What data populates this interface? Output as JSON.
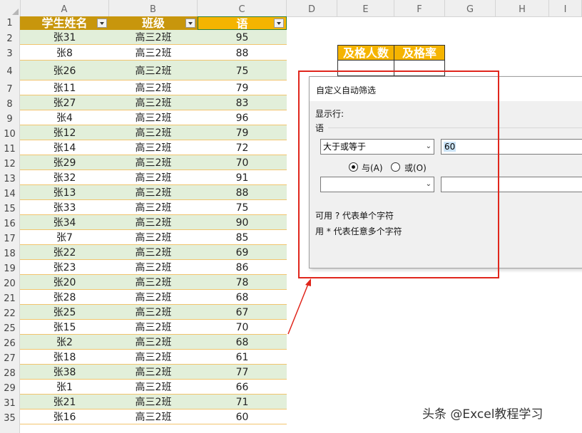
{
  "columns": [
    "A",
    "B",
    "C",
    "D",
    "E",
    "F",
    "G",
    "H",
    "I"
  ],
  "header": {
    "name": "学生姓名",
    "class": "班级",
    "score": "语"
  },
  "rows": [
    {
      "num": "2",
      "name": "张31",
      "class": "高三2班",
      "score": "95"
    },
    {
      "num": "3",
      "name": "张8",
      "class": "高三2班",
      "score": "88"
    },
    {
      "num": "4",
      "name": "张26",
      "class": "高三2班",
      "score": "75"
    },
    {
      "num": "7",
      "name": "张11",
      "class": "高三2班",
      "score": "79"
    },
    {
      "num": "8",
      "name": "张27",
      "class": "高三2班",
      "score": "83"
    },
    {
      "num": "9",
      "name": "张4",
      "class": "高三2班",
      "score": "96"
    },
    {
      "num": "10",
      "name": "张12",
      "class": "高三2班",
      "score": "79"
    },
    {
      "num": "11",
      "name": "张14",
      "class": "高三2班",
      "score": "72"
    },
    {
      "num": "12",
      "name": "张29",
      "class": "高三2班",
      "score": "70"
    },
    {
      "num": "13",
      "name": "张32",
      "class": "高三2班",
      "score": "91"
    },
    {
      "num": "14",
      "name": "张13",
      "class": "高三2班",
      "score": "88"
    },
    {
      "num": "15",
      "name": "张33",
      "class": "高三2班",
      "score": "75"
    },
    {
      "num": "16",
      "name": "张34",
      "class": "高三2班",
      "score": "90"
    },
    {
      "num": "17",
      "name": "张7",
      "class": "高三2班",
      "score": "85"
    },
    {
      "num": "18",
      "name": "张22",
      "class": "高三2班",
      "score": "69"
    },
    {
      "num": "19",
      "name": "张23",
      "class": "高三2班",
      "score": "86"
    },
    {
      "num": "20",
      "name": "张20",
      "class": "高三2班",
      "score": "78"
    },
    {
      "num": "21",
      "name": "张28",
      "class": "高三2班",
      "score": "68"
    },
    {
      "num": "22",
      "name": "张25",
      "class": "高三2班",
      "score": "67"
    },
    {
      "num": "25",
      "name": "张15",
      "class": "高三2班",
      "score": "70"
    },
    {
      "num": "26",
      "name": "张2",
      "class": "高三2班",
      "score": "68"
    },
    {
      "num": "27",
      "name": "张18",
      "class": "高三2班",
      "score": "61"
    },
    {
      "num": "28",
      "name": "张38",
      "class": "高三2班",
      "score": "77"
    },
    {
      "num": "29",
      "name": "张1",
      "class": "高三2班",
      "score": "66"
    },
    {
      "num": "31",
      "name": "张21",
      "class": "高三2班",
      "score": "71"
    },
    {
      "num": "35",
      "name": "张16",
      "class": "高三2班",
      "score": "60"
    }
  ],
  "stats": {
    "pass_count": "及格人数",
    "pass_rate": "及格率"
  },
  "dialog": {
    "title": "自定义自动筛选",
    "show_rows": "显示行:",
    "field": "语",
    "op1": "大于或等于",
    "val1": "60",
    "and_label": "与(A)",
    "or_label": "或(O)",
    "hint1": "可用 ? 代表单个字符",
    "hint2": "用 * 代表任意多个字符"
  },
  "watermark": "头条 @Excel教程学习",
  "colors": {
    "header": "#c8960c",
    "stat": "#f5b400",
    "band": "#e2efda",
    "highlight": "#e0261c"
  }
}
